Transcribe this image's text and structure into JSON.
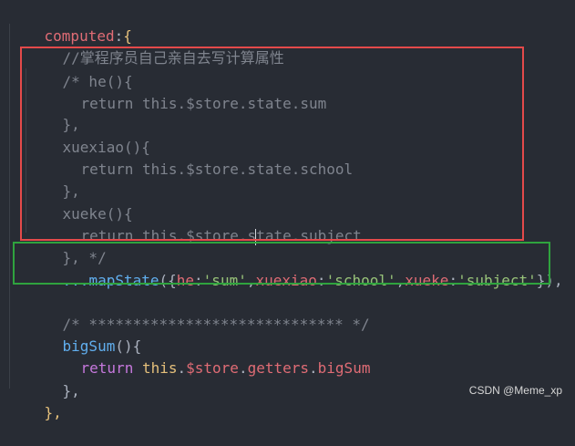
{
  "code": {
    "l0": "computed:{",
    "l1": "//掌程序员自己亲自去写计算属性",
    "l2a": "/* he(){",
    "l3a": "return this.$store.state.sum",
    "l4": "},",
    "l5": "xuexiao(){",
    "l6": "return this.$store.state.school",
    "l7": "},",
    "l8": "xueke(){",
    "l9a": "return this.$store.s",
    "l9b": "tate.subject",
    "l10": "}, */",
    "l11": {
      "spread": "...",
      "fn": "mapState",
      "open": "({",
      "k1": "he",
      "c1": ":",
      "v1": "'sum'",
      "sep1": ",",
      "k2": "xuexiao",
      "c2": ":",
      "v2": "'school'",
      "sep2": ",",
      "k3": "xueke",
      "c3": ":",
      "v3": "'subject'",
      "close": "}),"
    },
    "l12": "/* ***************************** */",
    "l13a": "bigSum",
    "l13b": "(){",
    "l14": {
      "ret": "return",
      "this": "this",
      "dot1": ".",
      "store": "$store",
      "dot2": ".",
      "getters": "getters",
      "dot3": ".",
      "big": "bigSum"
    },
    "l15": "},",
    "l16": "},"
  },
  "watermark": "CSDN @Meme_xp",
  "colors": {
    "background": "#282c34",
    "highlight_red": "#e44a4a",
    "highlight_green": "#2fa33e"
  }
}
